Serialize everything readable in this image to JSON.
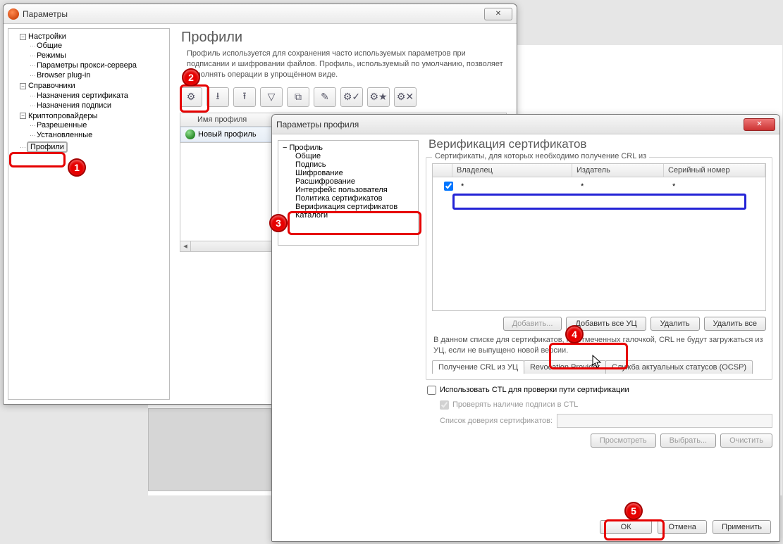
{
  "window1": {
    "title": "Параметры",
    "close_symbol": "✕",
    "tree": {
      "settings": "Настройки",
      "settings_children": [
        "Общие",
        "Режимы",
        "Параметры прокси-сервера",
        "Browser plug-in"
      ],
      "directories": "Справочники",
      "directories_children": [
        "Назначения сертификата",
        "Назначения подписи"
      ],
      "crypto": "Криптопровайдеры",
      "crypto_children": [
        "Разрешенные",
        "Установленные"
      ],
      "profiles": "Профили"
    },
    "content": {
      "heading": "Профили",
      "description": "Профиль используется для сохранения часто используемых параметров при подписании и шифровании файлов. Профиль, используемый по умолчанию, позволяет выполнять операции в упрощённом виде.",
      "toolbar_icons": [
        "gear-plus-icon",
        "tray-down-icon",
        "tray-up-icon",
        "funnel-icon",
        "copy-icon",
        "edit-icon",
        "gear-check-icon",
        "gear-star-icon",
        "gear-cross-icon"
      ],
      "table_header": "Имя профиля",
      "table_row": "Новый профиль"
    }
  },
  "window2": {
    "title": "Параметры профиля",
    "close_symbol": "✕",
    "tree": {
      "root": "Профиль",
      "children": [
        "Общие",
        "Подпись",
        "Шифрование",
        "Расшифрование",
        "Интерфейс пользователя",
        "Политика сертификатов",
        "Верификация сертификатов",
        "Каталоги"
      ]
    },
    "panel": {
      "heading": "Верификация сертификатов",
      "fieldset_legend": "Сертификаты, для которых необходимо получение CRL из",
      "columns": [
        "",
        "Владелец",
        "Издатель",
        "Серийный номер"
      ],
      "row": {
        "checked": true,
        "owner": "*",
        "issuer": "*",
        "serial": "*"
      },
      "btn_add": "Добавить...",
      "btn_add_all": "Добавить все УЦ",
      "btn_delete": "Удалить",
      "btn_delete_all": "Удалить все",
      "note": "В данном списке для сертификатов, не отмеченных галочкой, CRL не будут загружаться из УЦ, если не выпущено новой версии.",
      "tabs": [
        "Получение CRL из УЦ",
        "Revocation Provider",
        "Служба актуальных статусов (OCSP)"
      ],
      "chk_ctl": "Использовать CTL для проверки пути сертификации",
      "chk_signature": "Проверять наличие подписи в CTL",
      "trust_label": "Список доверия сертификатов:",
      "btn_view": "Просмотреть",
      "btn_choose": "Выбрать...",
      "btn_clear": "Очистить"
    },
    "footer": {
      "ok": "ОК",
      "cancel": "Отмена",
      "apply": "Применить"
    }
  },
  "annotations": {
    "n1": "1",
    "n2": "2",
    "n3": "3",
    "n4": "4",
    "n5": "5"
  }
}
